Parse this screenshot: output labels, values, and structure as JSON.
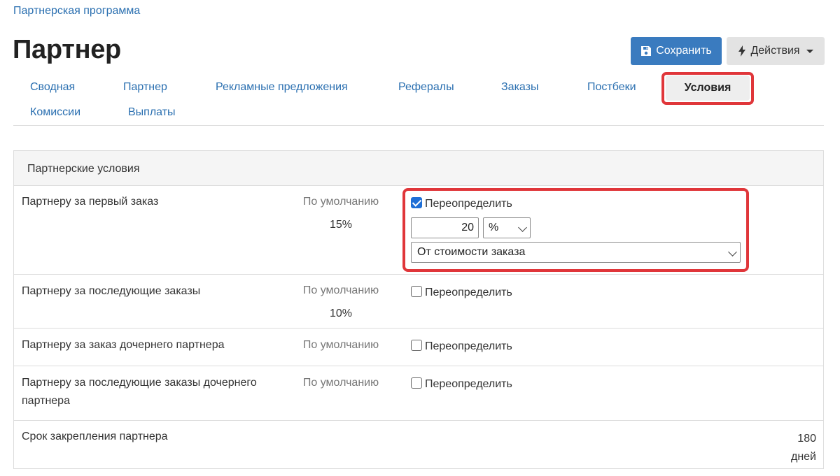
{
  "breadcrumb": "Партнерская программа",
  "page_title": "Партнер",
  "toolbar": {
    "save_label": "Сохранить",
    "save_icon": "floppy-disk-icon",
    "actions_label": "Действия",
    "actions_icon": "lightning-bolt-icon"
  },
  "tabs": [
    {
      "label": "Сводная",
      "active": false
    },
    {
      "label": "Партнер",
      "active": false
    },
    {
      "label": "Рекламные предложения",
      "active": false
    },
    {
      "label": "Рефералы",
      "active": false
    },
    {
      "label": "Заказы",
      "active": false
    },
    {
      "label": "Постбеки",
      "active": false
    },
    {
      "label": "Условия",
      "active": true
    },
    {
      "label": "Комиссии",
      "active": false
    },
    {
      "label": "Выплаты",
      "active": false
    }
  ],
  "panel": {
    "title": "Партнерские условия",
    "default_label": "По умолчанию",
    "override_label": "Переопределить",
    "rows": [
      {
        "label": "Партнеру за первый заказ",
        "default_value": "15%",
        "override_checked": true,
        "override_amount": "20",
        "override_unit": "%",
        "override_base": "От стоимости заказа"
      },
      {
        "label": "Партнеру за последующие заказы",
        "default_value": "10%",
        "override_checked": false
      },
      {
        "label": "Партнеру за заказ дочернего партнера",
        "default_value": "",
        "override_checked": false
      },
      {
        "label": "Партнеру за последующие заказы дочернего партнера",
        "default_value": "",
        "override_checked": false
      }
    ],
    "term": {
      "label": "Срок закрепления партнера",
      "value": "180",
      "unit": "дней"
    }
  },
  "colors": {
    "accent": "#3a7bbf",
    "link": "#2a6fb0",
    "highlight": "#e0363a",
    "checkbox": "#1f6fd6"
  }
}
